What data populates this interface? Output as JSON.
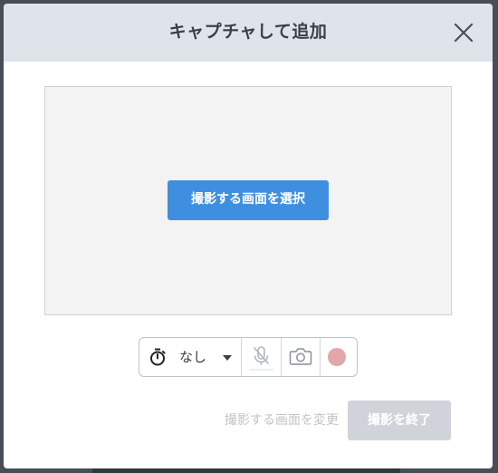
{
  "dialog": {
    "title": "キャプチャして追加",
    "close_icon": "close-icon"
  },
  "preview": {
    "select_button_label": "撮影する画面を選択"
  },
  "toolbar": {
    "timer_icon": "stopwatch-icon",
    "timer_value": "なし",
    "mic_icon": "mic-off-icon",
    "camera_icon": "camera-icon",
    "record_icon": "record-icon"
  },
  "footer": {
    "change_screen_label": "撮影する画面を変更",
    "finish_button_label": "撮影を終了"
  },
  "colors": {
    "header_bg": "#dfe3ea",
    "primary_button": "#3f8fe0",
    "record_dot": "#e3a6a9",
    "disabled_button": "#d0d4da"
  }
}
